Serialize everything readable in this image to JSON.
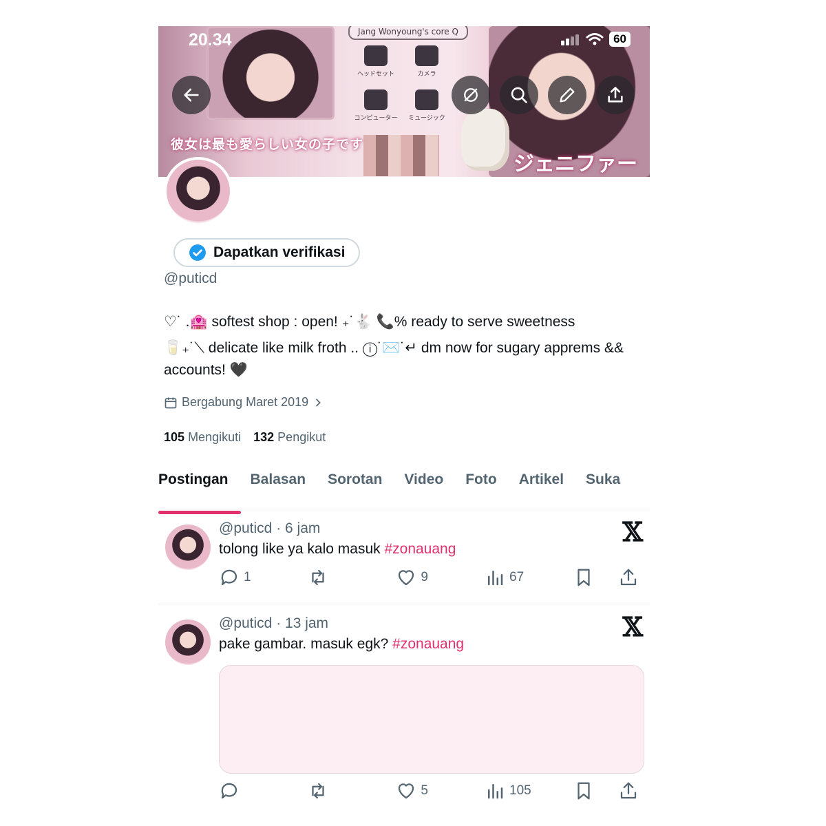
{
  "status": {
    "time": "20.34",
    "battery": "60"
  },
  "banner": {
    "pill": "Jang Wonyoung's core Q",
    "jp_left": "彼女は最も愛らしい女の子です",
    "jp_right": "ジェニファー",
    "apps": [
      "ヘッドセット",
      "カメラ",
      "コンピューター",
      "ミュージック"
    ]
  },
  "profile": {
    "verify_label": "Dapatkan verifikasi",
    "handle": "@puticd",
    "bio_line1": "♡˙ .🏩 softest shop : open! ₊˙🐇 📞% ready to serve sweetness",
    "bio_line2": "🥛₊˙⟍ delicate like milk froth .. ⓘ˙✉️˙↵ dm now for sugary apprems && accounts! 🖤",
    "joined": "Bergabung Maret 2019",
    "following_count": "105",
    "following_label": "Mengikuti",
    "followers_count": "132",
    "followers_label": "Pengikut"
  },
  "tabs": [
    "Postingan",
    "Balasan",
    "Sorotan",
    "Video",
    "Foto",
    "Artikel",
    "Suka"
  ],
  "posts": [
    {
      "meta": "@puticd · 6 jam",
      "text": "tolong like ya kalo masuk ",
      "tag": "#zonauang",
      "replies": "1",
      "reposts": "",
      "likes": "9",
      "views": "67"
    },
    {
      "meta": "@puticd · 13 jam",
      "text": "pake gambar. masuk egk? ",
      "tag": "#zonauang",
      "replies": "",
      "reposts": "",
      "likes": "5",
      "views": "105"
    }
  ],
  "colors": {
    "accent": "#e1306c",
    "verified": "#1d9bf0",
    "muted": "#536471"
  },
  "icons": [
    "back-arrow-icon",
    "sync-off-icon",
    "search-icon",
    "edit-icon",
    "share-icon",
    "verified-badge-icon",
    "calendar-icon",
    "chevron-right-icon",
    "reply-icon",
    "repost-icon",
    "like-icon",
    "views-icon",
    "bookmark-icon",
    "x-logo-icon"
  ]
}
